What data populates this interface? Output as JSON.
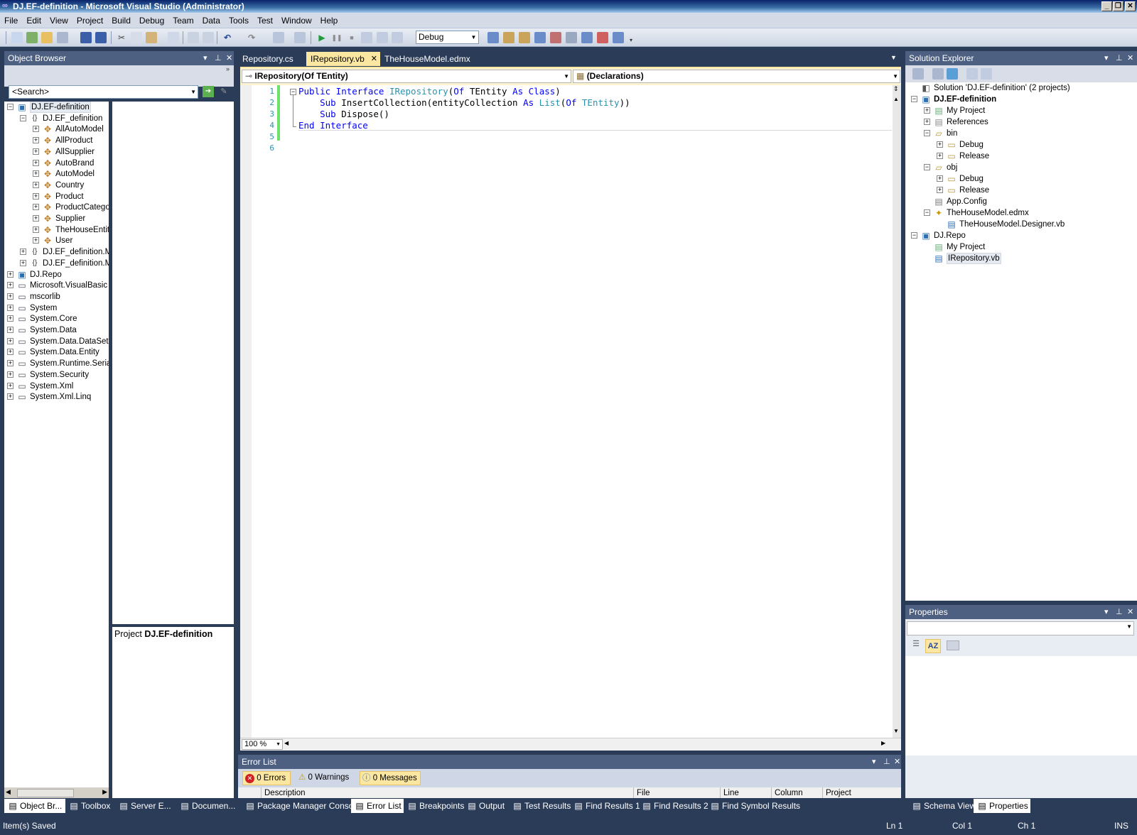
{
  "window": {
    "title": "DJ.EF-definition - Microsoft Visual Studio (Administrator)"
  },
  "menu": [
    "File",
    "Edit",
    "View",
    "Project",
    "Build",
    "Debug",
    "Team",
    "Data",
    "Tools",
    "Test",
    "Window",
    "Help"
  ],
  "toolbar": {
    "config": "Debug"
  },
  "object_browser": {
    "title": "Object Browser",
    "search_placeholder": "<Search>",
    "tree": [
      {
        "label": "DJ.EF-definition",
        "level": 0,
        "exp": "−",
        "icon": "vb-project-icon",
        "selected": true
      },
      {
        "label": "DJ.EF_definition",
        "level": 1,
        "exp": "−",
        "icon": "namespace-icon"
      },
      {
        "label": "AllAutoModel",
        "level": 2,
        "exp": "+",
        "icon": "class-icon"
      },
      {
        "label": "AllProduct",
        "level": 2,
        "exp": "+",
        "icon": "class-icon"
      },
      {
        "label": "AllSupplier",
        "level": 2,
        "exp": "+",
        "icon": "class-icon"
      },
      {
        "label": "AutoBrand",
        "level": 2,
        "exp": "+",
        "icon": "class-icon"
      },
      {
        "label": "AutoModel",
        "level": 2,
        "exp": "+",
        "icon": "class-icon"
      },
      {
        "label": "Country",
        "level": 2,
        "exp": "+",
        "icon": "class-icon"
      },
      {
        "label": "Product",
        "level": 2,
        "exp": "+",
        "icon": "class-icon"
      },
      {
        "label": "ProductCatego",
        "level": 2,
        "exp": "+",
        "icon": "class-icon"
      },
      {
        "label": "Supplier",
        "level": 2,
        "exp": "+",
        "icon": "class-icon"
      },
      {
        "label": "TheHouseEntit",
        "level": 2,
        "exp": "+",
        "icon": "class-icon"
      },
      {
        "label": "User",
        "level": 2,
        "exp": "+",
        "icon": "class-icon"
      },
      {
        "label": "DJ.EF_definition.M",
        "level": 1,
        "exp": "+",
        "icon": "namespace-icon"
      },
      {
        "label": "DJ.EF_definition.M",
        "level": 1,
        "exp": "+",
        "icon": "namespace-icon"
      },
      {
        "label": "DJ.Repo",
        "level": 0,
        "exp": "+",
        "icon": "vb-project-icon"
      },
      {
        "label": "Microsoft.VisualBasic",
        "level": 0,
        "exp": "+",
        "icon": "assembly-icon"
      },
      {
        "label": "mscorlib",
        "level": 0,
        "exp": "+",
        "icon": "assembly-icon"
      },
      {
        "label": "System",
        "level": 0,
        "exp": "+",
        "icon": "assembly-icon"
      },
      {
        "label": "System.Core",
        "level": 0,
        "exp": "+",
        "icon": "assembly-icon"
      },
      {
        "label": "System.Data",
        "level": 0,
        "exp": "+",
        "icon": "assembly-icon"
      },
      {
        "label": "System.Data.DataSetE",
        "level": 0,
        "exp": "+",
        "icon": "assembly-icon"
      },
      {
        "label": "System.Data.Entity",
        "level": 0,
        "exp": "+",
        "icon": "assembly-icon"
      },
      {
        "label": "System.Runtime.Serial",
        "level": 0,
        "exp": "+",
        "icon": "assembly-icon"
      },
      {
        "label": "System.Security",
        "level": 0,
        "exp": "+",
        "icon": "assembly-icon"
      },
      {
        "label": "System.Xml",
        "level": 0,
        "exp": "+",
        "icon": "assembly-icon"
      },
      {
        "label": "System.Xml.Linq",
        "level": 0,
        "exp": "+",
        "icon": "assembly-icon"
      }
    ],
    "detail_prefix": "Project",
    "detail_name": "DJ.EF-definition"
  },
  "editor": {
    "tabs": [
      {
        "label": "Repository.cs",
        "active": false
      },
      {
        "label": "IRepository.vb",
        "active": true
      },
      {
        "label": "TheHouseModel.edmx",
        "active": false
      }
    ],
    "type_dropdown": "IRepository(Of TEntity)",
    "member_dropdown": "(Declarations)",
    "zoom": "100 %",
    "line_numbers": [
      "1",
      "2",
      "3",
      "4",
      "5",
      "6"
    ],
    "code": [
      [
        {
          "t": "Public Interface ",
          "c": "kw"
        },
        {
          "t": "IRepository",
          "c": "ty"
        },
        {
          "t": "(",
          "c": ""
        },
        {
          "t": "Of ",
          "c": "kw"
        },
        {
          "t": "TEntity ",
          "c": ""
        },
        {
          "t": "As Class",
          "c": "kw"
        },
        {
          "t": ")",
          "c": ""
        }
      ],
      [
        {
          "t": "    Sub ",
          "c": "kw"
        },
        {
          "t": "InsertCollection(entityCollection ",
          "c": ""
        },
        {
          "t": "As ",
          "c": "kw"
        },
        {
          "t": "List",
          "c": "ty"
        },
        {
          "t": "(",
          "c": ""
        },
        {
          "t": "Of ",
          "c": "kw"
        },
        {
          "t": "TEntity",
          "c": "ty"
        },
        {
          "t": "))",
          "c": ""
        }
      ],
      [
        {
          "t": "    Sub ",
          "c": "kw"
        },
        {
          "t": "Dispose()",
          "c": ""
        }
      ],
      [
        {
          "t": "End Interface",
          "c": "kw"
        }
      ],
      [],
      []
    ]
  },
  "solution_explorer": {
    "title": "Solution Explorer",
    "tree": [
      {
        "label": "Solution 'DJ.EF-definition' (2 projects)",
        "level": 0,
        "exp": "",
        "icon": "solution-icon",
        "bold": false
      },
      {
        "label": "DJ.EF-definition",
        "level": 0,
        "exp": "−",
        "icon": "vb-project-icon",
        "bold": true
      },
      {
        "label": "My Project",
        "level": 1,
        "exp": "+",
        "icon": "my-project-icon"
      },
      {
        "label": "References",
        "level": 1,
        "exp": "+",
        "icon": "references-icon"
      },
      {
        "label": "bin",
        "level": 1,
        "exp": "−",
        "icon": "folder-open-icon"
      },
      {
        "label": "Debug",
        "level": 2,
        "exp": "+",
        "icon": "folder-icon"
      },
      {
        "label": "Release",
        "level": 2,
        "exp": "+",
        "icon": "folder-icon"
      },
      {
        "label": "obj",
        "level": 1,
        "exp": "−",
        "icon": "folder-open-icon"
      },
      {
        "label": "Debug",
        "level": 2,
        "exp": "+",
        "icon": "folder-icon"
      },
      {
        "label": "Release",
        "level": 2,
        "exp": "+",
        "icon": "folder-icon"
      },
      {
        "label": "App.Config",
        "level": 1,
        "exp": "",
        "icon": "config-file-icon"
      },
      {
        "label": "TheHouseModel.edmx",
        "level": 1,
        "exp": "−",
        "icon": "edmx-icon"
      },
      {
        "label": "TheHouseModel.Designer.vb",
        "level": 2,
        "exp": "",
        "icon": "vb-file-icon"
      },
      {
        "label": "DJ.Repo",
        "level": 0,
        "exp": "−",
        "icon": "vb-project-icon"
      },
      {
        "label": "My Project",
        "level": 1,
        "exp": "",
        "icon": "my-project-icon"
      },
      {
        "label": "IRepository.vb",
        "level": 1,
        "exp": "",
        "icon": "vb-file-icon",
        "selected": true
      }
    ]
  },
  "properties": {
    "title": "Properties"
  },
  "error_list": {
    "title": "Error List",
    "errors": "0 Errors",
    "warnings": "0 Warnings",
    "messages": "0 Messages",
    "columns": [
      "Description",
      "File",
      "Line",
      "Column",
      "Project"
    ]
  },
  "bottom_tabs_left": [
    "Object Br...",
    "Toolbox",
    "Server E...",
    "Documen..."
  ],
  "bottom_tabs_center": [
    "Package Manager Console",
    "Error List",
    "Breakpoints",
    "Output",
    "Test Results",
    "Find Results 1",
    "Find Results 2",
    "Find Symbol Results"
  ],
  "bottom_tabs_right": [
    "Schema View",
    "Properties"
  ],
  "status": {
    "message": "Item(s) Saved",
    "ln": "Ln 1",
    "col": "Col 1",
    "ch": "Ch 1",
    "mode": "INS"
  },
  "colors": {
    "keyword": "#0000ff",
    "type": "#2b91af",
    "chrome": "#2b3c59",
    "active_tab": "#fbe7a1"
  }
}
